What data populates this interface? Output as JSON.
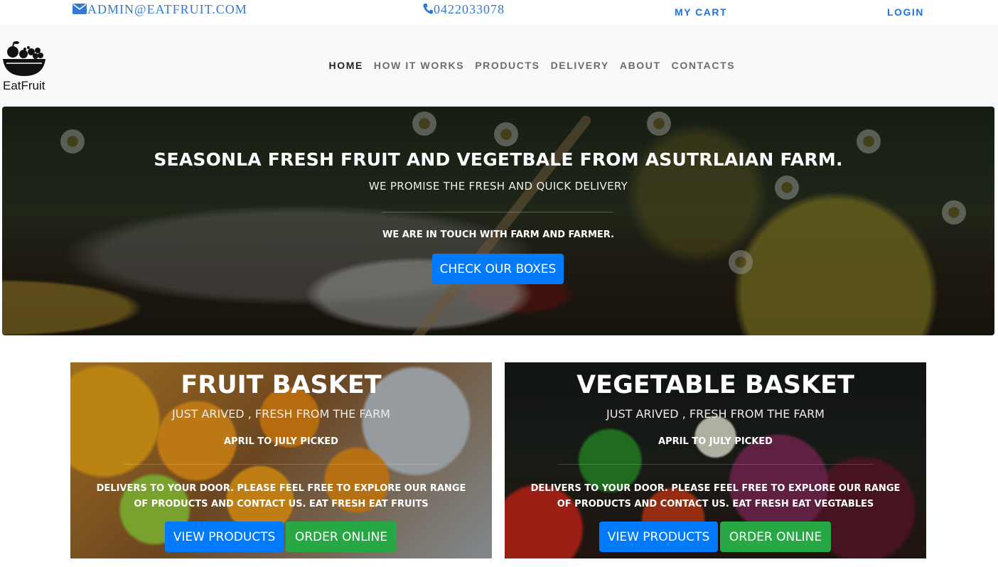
{
  "topbar": {
    "email": "ADMIN@EATFRUIT.COM",
    "phone": "0422033078",
    "cart_label": "MY CART",
    "login_label": "LOGIN",
    "email_icon": "envelope-icon",
    "phone_icon": "phone-icon",
    "accent_color": "#1a73e8"
  },
  "brand": {
    "name": "EatFruit",
    "logo_icon": "fruit-basket-icon"
  },
  "nav": {
    "items": [
      {
        "label": "HOME",
        "active": true
      },
      {
        "label": "HOW IT WORKS",
        "active": false
      },
      {
        "label": "PRODUCTS",
        "active": false
      },
      {
        "label": "DELIVERY",
        "active": false
      },
      {
        "label": "ABOUT",
        "active": false
      },
      {
        "label": "CONTACTS",
        "active": false
      }
    ]
  },
  "hero": {
    "title": "SEASONLA FRESH FRUIT AND VEGETBALE FROM ASUTRLAIAN FARM.",
    "subtitle": "WE PROMISE THE FRESH AND QUICK DELIVERY",
    "note": "WE ARE IN TOUCH WITH FARM AND FARMER.",
    "button_label": "CHECK OUR BOXES",
    "button_color": "#007bff"
  },
  "cards": [
    {
      "title": "FRUIT BASKET",
      "subtitle": "JUST ARIVED , FRESH FROM THE FARM",
      "picked": "APRIL TO JULY PICKED",
      "description": "DELIVERS TO YOUR DOOR. PLEASE FEEL FREE TO EXPLORE OUR RANGE OF PRODUCTS AND CONTACT US. EAT FRESH EAT FRUITS",
      "view_label": "VIEW PRODUCTS",
      "order_label": "ORDER ONLINE"
    },
    {
      "title": "VEGETABLE BASKET",
      "subtitle": "JUST ARIVED , FRESH FROM THE FARM",
      "picked": "APRIL TO JULY PICKED",
      "description": "DELIVERS TO YOUR DOOR. PLEASE FEEL FREE TO EXPLORE OUR RANGE OF PRODUCTS AND CONTACT US. EAT FRESH EAT VEGTABLES",
      "view_label": "VIEW PRODUCTS",
      "order_label": "ORDER ONLINE"
    }
  ],
  "colors": {
    "primary": "#007bff",
    "success": "#28a745",
    "navbar_bg": "#f8f9fa"
  }
}
